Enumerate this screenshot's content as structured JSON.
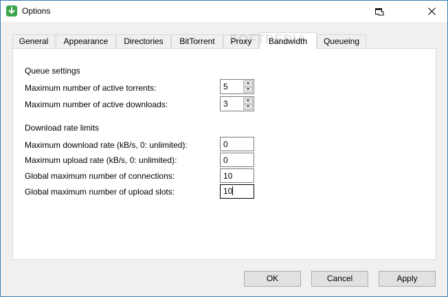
{
  "window": {
    "title": "Options"
  },
  "tabs": [
    {
      "label": "General"
    },
    {
      "label": "Appearance"
    },
    {
      "label": "Directories"
    },
    {
      "label": "BitTorrent"
    },
    {
      "label": "Proxy"
    },
    {
      "label": "Bandwidth",
      "active": true
    },
    {
      "label": "Queueing"
    }
  ],
  "queue": {
    "heading": "Queue settings",
    "max_active_torrents": {
      "label": "Maximum number of active torrents:",
      "value": "5"
    },
    "max_active_downloads": {
      "label": "Maximum number of active downloads:",
      "value": "3"
    }
  },
  "rates": {
    "heading": "Download rate limits",
    "max_download_rate": {
      "label": "Maximum download rate (kB/s, 0: unlimited):",
      "value": "0"
    },
    "max_upload_rate": {
      "label": "Maximum upload rate (kB/s, 0: unlimited):",
      "value": "0"
    },
    "global_max_connections": {
      "label": "Global maximum number of connections:",
      "value": "10"
    },
    "global_max_upload_slots": {
      "label": "Global maximum number of upload slots:",
      "value": "10"
    }
  },
  "buttons": {
    "ok": "OK",
    "cancel": "Cancel",
    "apply": "Apply"
  },
  "watermark": "SOFTPEDIA",
  "colors": {
    "window_border": "#3c7fb1",
    "app_icon": "#3aa54a",
    "panel_bg": "#ffffff",
    "dialog_bg": "#f0f0f0"
  },
  "icons": {
    "app": "download-arrow-icon",
    "help": "context-help-icon",
    "close": "close-icon"
  }
}
